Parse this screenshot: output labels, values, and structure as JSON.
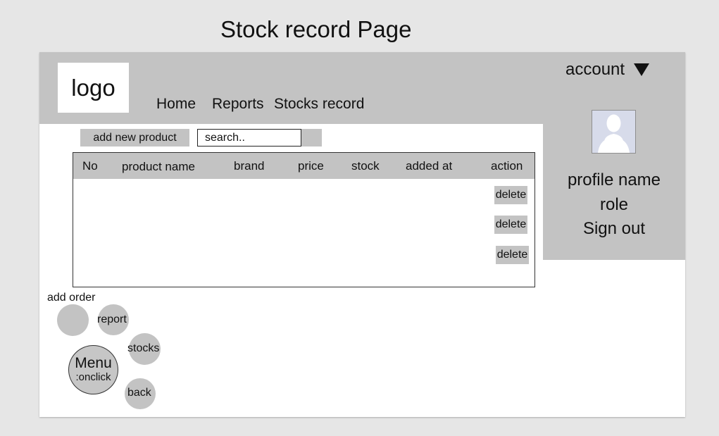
{
  "page_title": "Stock record Page",
  "header": {
    "logo": "logo",
    "nav": [
      {
        "label": "Home"
      },
      {
        "label": "Reports"
      },
      {
        "label": "Stocks record"
      }
    ],
    "account_label": "account"
  },
  "profile": {
    "name": "profile name",
    "role": "role",
    "sign_out": "Sign out"
  },
  "toolbar": {
    "add_new_product": "add new product",
    "search_placeholder": "search.."
  },
  "table": {
    "columns": [
      "No",
      "product name",
      "brand",
      "price",
      "stock",
      "added at",
      "action"
    ],
    "delete_label": "delete"
  },
  "floating_menu": {
    "add_order": "add order",
    "report": "report",
    "stocks": "stocks",
    "back": "back",
    "menu_title": "Menu",
    "menu_subtitle": ":onclick"
  }
}
